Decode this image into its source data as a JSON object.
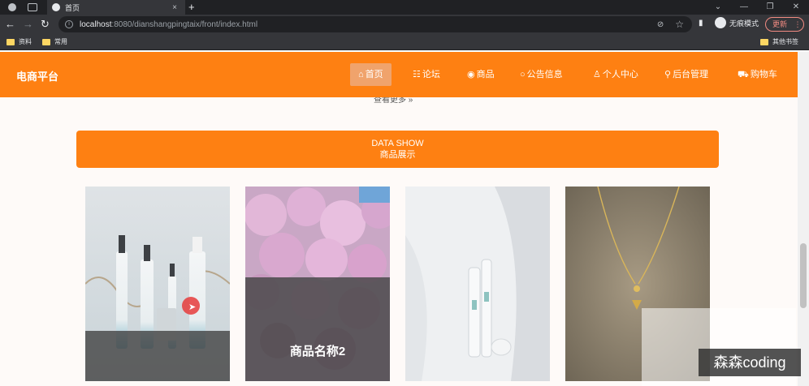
{
  "browser": {
    "tab_title": "首页",
    "tab_close": "×",
    "new_tab": "+",
    "url_host": "localhost",
    "url_rest": ":8080/dianshangpingtaix/front/index.html",
    "incognito_label": "无痕模式",
    "update_label": "更新",
    "update_menu": "⋮",
    "bookmarks": [
      "资料",
      "常用"
    ],
    "other_bookmarks": "其他书签",
    "nav_icons": {
      "back": "←",
      "forward": "→",
      "reload": "↻"
    }
  },
  "site": {
    "brand": "电商平台",
    "nav": [
      {
        "icon": "⌂",
        "label": "首页"
      },
      {
        "icon": "☷",
        "label": "论坛"
      },
      {
        "icon": "◉",
        "label": "商品"
      },
      {
        "icon": "○",
        "label": "公告信息"
      },
      {
        "icon": "♙",
        "label": "个人中心"
      },
      {
        "icon": "⚲",
        "label": "后台管理"
      },
      {
        "icon": "⛟",
        "label": "购物车"
      }
    ],
    "more_link": "查看更多 »",
    "section": {
      "title_en": "DATA SHOW",
      "title_zh": "商品展示"
    },
    "products": [
      {
        "name": ""
      },
      {
        "name": "商品名称2"
      },
      {
        "name": ""
      },
      {
        "name": ""
      }
    ],
    "accent_color": "#fe8012"
  },
  "watermark": "森森coding"
}
